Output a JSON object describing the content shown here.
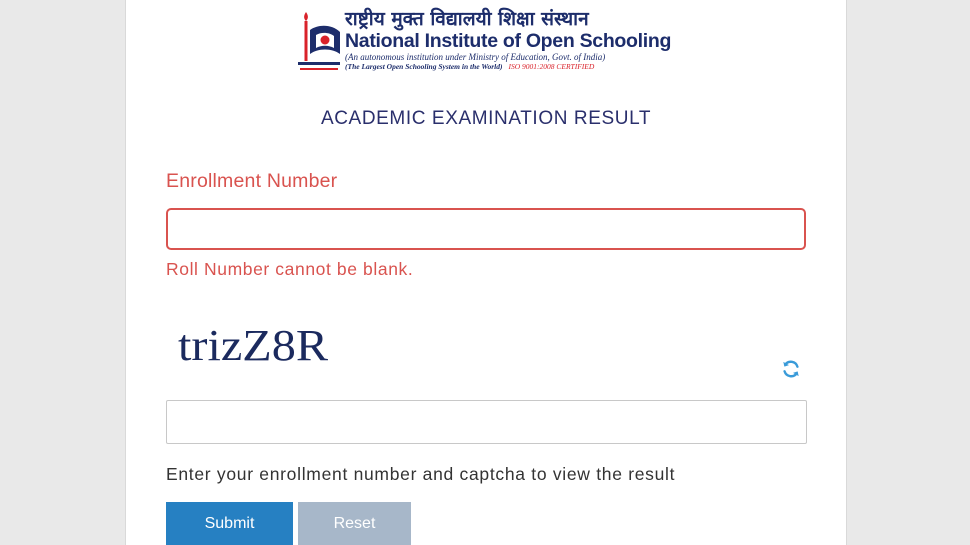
{
  "header": {
    "logo": {
      "hindi_name": "राष्ट्रीय मुक्त विद्यालयी शिक्षा संस्थान",
      "english_name_prefix": "National Institute of ",
      "english_name_emphasis": "Open Schooling",
      "subline": "(An autonomous institution under Ministry of Education, Govt. of India)",
      "tagline": "(The Largest Open Schooling System in the World)",
      "certification": "ISO 9001:2008 CERTIFIED"
    },
    "page_title": "ACADEMIC EXAMINATION RESULT"
  },
  "form": {
    "enrollment_label": "Enrollment Number",
    "enrollment_value": "",
    "enrollment_error": "Roll Number cannot be blank.",
    "captcha_text": "trizZ8R",
    "captcha_value": "",
    "help_text": "Enter your enrollment number and captcha to view the result",
    "submit_label": "Submit",
    "reset_label": "Reset"
  },
  "icons": {
    "refresh": "refresh-icon",
    "logo": "nios-emblem-icon"
  },
  "colors": {
    "brand_navy": "#1d2d6b",
    "error_red": "#d9534f",
    "primary_button": "#2680c2",
    "disabled_button": "#a7b7c9",
    "page_background": "#e9e9e9"
  }
}
